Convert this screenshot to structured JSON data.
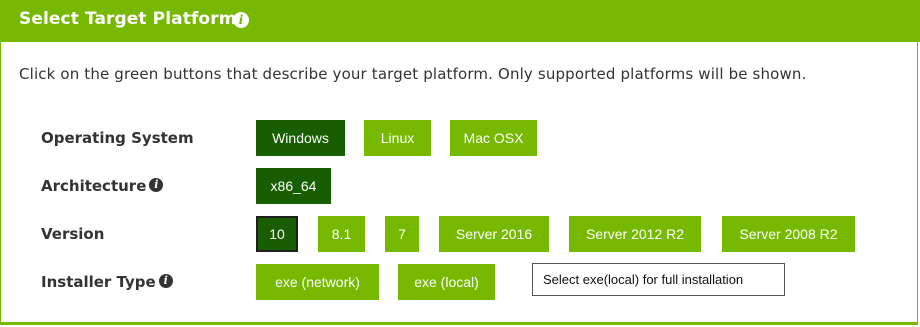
{
  "header": {
    "title": "Select Target Platform",
    "icon": "info-icon"
  },
  "description": "Click on the green buttons that describe your target platform. Only supported platforms will be shown.",
  "rows": {
    "os": {
      "label": "Operating System",
      "options": [
        "Windows",
        "Linux",
        "Mac OSX"
      ],
      "selected": "Windows"
    },
    "arch": {
      "label": "Architecture",
      "options": [
        "x86_64"
      ],
      "selected": "x86_64"
    },
    "version": {
      "label": "Version",
      "options": [
        "10",
        "8.1",
        "7",
        "Server 2016",
        "Server 2012 R2",
        "Server 2008 R2"
      ],
      "selected": "10"
    },
    "installer": {
      "label": "Installer Type",
      "options": [
        "exe (network)",
        "exe (local)"
      ],
      "selected": null
    }
  },
  "annotation": "Select exe(local) for full installation",
  "colors": {
    "accent": "#76b900",
    "selected": "#185e00",
    "text": "#333333"
  }
}
